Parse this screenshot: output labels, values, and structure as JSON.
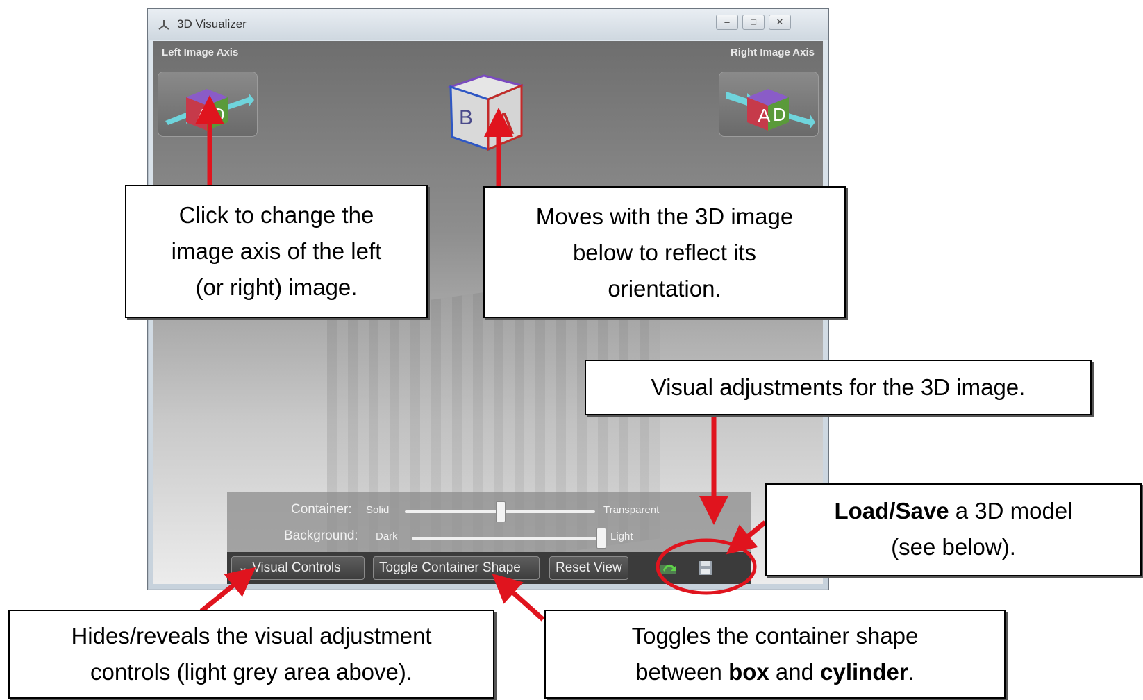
{
  "window": {
    "title": "3D Visualizer",
    "minimize_glyph": "–",
    "maximize_glyph": "□",
    "close_glyph": "✕"
  },
  "viewport": {
    "left_axis_label": "Left Image Axis",
    "right_axis_label": "Right Image Axis",
    "cube_faces": {
      "front": "A",
      "side": "D",
      "left": "B"
    }
  },
  "visual_controls": {
    "container": {
      "label": "Container:",
      "min_label": "Solid",
      "max_label": "Transparent",
      "value": 0.5
    },
    "background": {
      "label": "Background:",
      "min_label": "Dark",
      "max_label": "Light",
      "value": 1.0
    }
  },
  "button_bar": {
    "visual_controls_label": "Visual Controls",
    "visual_controls_chevron": "⌄",
    "toggle_shape_label": "Toggle Container Shape",
    "reset_view_label": "Reset View"
  },
  "annotations": {
    "axis_button": [
      "Click to change the",
      "image axis of the left",
      "(or right) image."
    ],
    "orientation_cube": [
      "Moves with the 3D image",
      "below to reflect its",
      "orientation."
    ],
    "visual_adjustments": "Visual adjustments for the 3D image.",
    "load_save": {
      "bold": "Load/Save",
      "rest_line1": " a 3D model",
      "line2": "(see below)."
    },
    "hides_reveals": [
      "Hides/reveals the visual adjustment",
      "controls (light grey area above)."
    ],
    "toggles_shape": {
      "line1": "Toggles the container shape",
      "between": "between ",
      "box": "box",
      "and": " and ",
      "cylinder": "cylinder",
      "period": "."
    }
  },
  "colors": {
    "arrow": "#e0141e",
    "highlight_ring": "#e0141e"
  }
}
